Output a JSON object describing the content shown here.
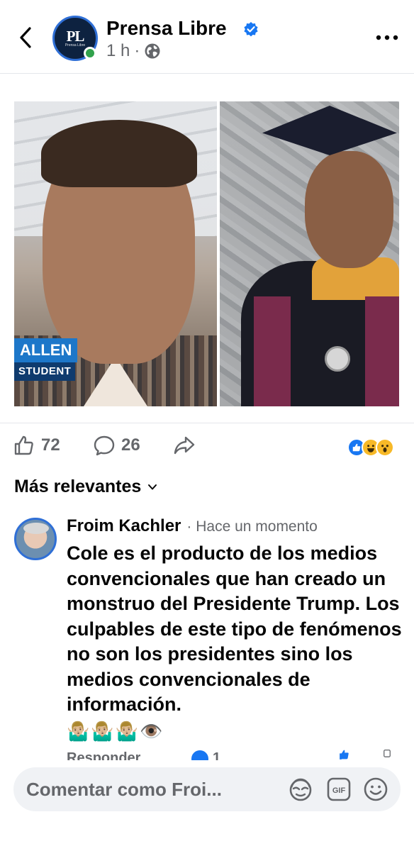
{
  "header": {
    "page_name": "Prensa Libre",
    "time": "1 h",
    "separator": "·",
    "avatar_initials": "PL",
    "avatar_subtitle": "Prensa Libre",
    "icons": [
      "back-chevron-icon",
      "verified-badge-icon",
      "globe-icon",
      "more-options-icon"
    ]
  },
  "post_image": {
    "left_caption_name": "ALLEN",
    "left_caption_role": "STUDENT"
  },
  "post_actions": {
    "like_count": "72",
    "comment_count": "26",
    "reactions": [
      "like",
      "haha",
      "wow"
    ]
  },
  "comments_filter": {
    "label": "Más relevantes"
  },
  "comment": {
    "author": "Froim Kachler",
    "time": "· Hace un momento",
    "text": "Cole es el producto de los medios convencionales que han creado un monstruo del Presidente Trump.  Los culpables de este tipo de fenómenos no son los presidentes sino los medios convencionales de información.",
    "emoji": "🤷🏼‍♂️🤷🏼‍♂️🤷🏼‍♂️👁️",
    "reply_label": "Responder",
    "reaction_count": "1"
  },
  "composer": {
    "placeholder": "Comentar como Froi..."
  },
  "colors": {
    "accent": "#1877f2",
    "secondary_text": "#65676b",
    "online": "#31a24c"
  }
}
